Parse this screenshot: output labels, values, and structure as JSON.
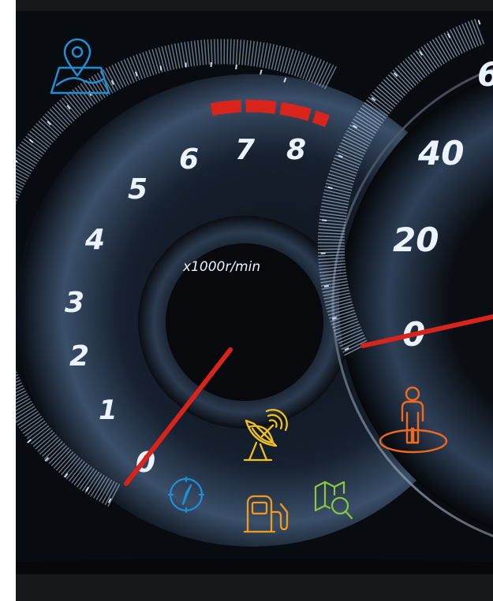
{
  "tachometer": {
    "unit_label": "x1000r/min",
    "numbers": [
      "0",
      "1",
      "2",
      "3",
      "4",
      "5",
      "6",
      "7",
      "8"
    ]
  },
  "speedometer": {
    "numbers": [
      "0",
      "20",
      "40",
      "6"
    ]
  },
  "icons": [
    {
      "name": "map-location-icon",
      "color": "#1f8fd6"
    },
    {
      "name": "satellite-dish-icon",
      "color": "#f2c21b"
    },
    {
      "name": "compass-icon",
      "color": "#1f8fd6"
    },
    {
      "name": "fuel-pump-icon",
      "color": "#f39a1b"
    },
    {
      "name": "map-search-icon",
      "color": "#8cc63f"
    },
    {
      "name": "person-on-platform-icon",
      "color": "#f06a1d"
    }
  ],
  "colors": {
    "background": "#080b10",
    "needle": "#d8241b",
    "scale_glow": "#cfe6ff",
    "redline": "#d8241b"
  }
}
